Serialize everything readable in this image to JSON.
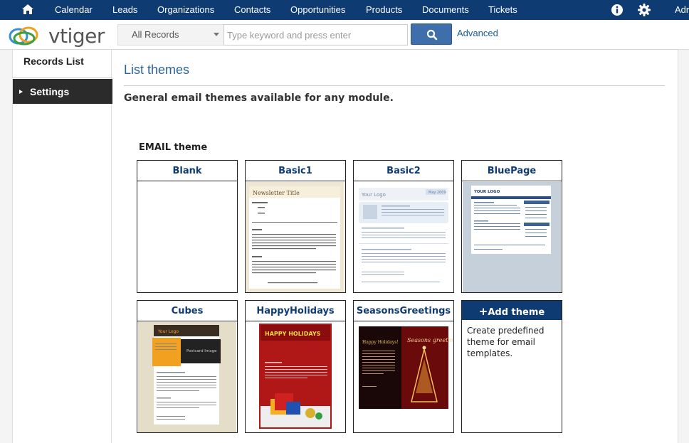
{
  "topnav": {
    "items": [
      "Calendar",
      "Leads",
      "Organizations",
      "Contacts",
      "Opportunities",
      "Products",
      "Documents",
      "Tickets"
    ],
    "user": "Adr"
  },
  "search": {
    "logo_text": "vtiger",
    "scope": "All Records",
    "placeholder": "Type keyword and press enter",
    "advanced_label": "Advanced"
  },
  "sidebar": {
    "records_list": "Records List",
    "settings": "Settings"
  },
  "main": {
    "title": "List themes",
    "subtitle": "General email themes available for any module.",
    "section": "EMAIL theme",
    "themes": [
      {
        "name": "Blank"
      },
      {
        "name": "Basic1",
        "thumb_title": "Newsletter Title"
      },
      {
        "name": "Basic2",
        "thumb_title": "Your Logo",
        "thumb_badge": "May 2009"
      },
      {
        "name": "BluePage",
        "thumb_title": "YOUR LOGO"
      },
      {
        "name": "Cubes",
        "thumb_title": "Your Logo",
        "thumb_sub": "Postcard Image"
      },
      {
        "name": "HappyHolidays",
        "thumb_title": "HAPPY HOLIDAYS"
      },
      {
        "name": "SeasonsGreetings",
        "thumb_title": "Happy Holidays!",
        "thumb_sub": "Seasons greetings"
      }
    ],
    "add_theme": {
      "label": "Add theme",
      "description": "Create predefined theme for email templates."
    }
  },
  "colors": {
    "nav_bg": "#0f3b73",
    "link": "#2a6496",
    "search_button": "#3e6faa"
  }
}
